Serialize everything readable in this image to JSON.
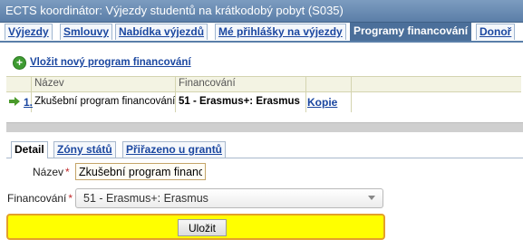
{
  "window": {
    "title": "ECTS koordinátor: Výjezdy studentů na krátkodobý pobyt (S035)"
  },
  "tabs": [
    {
      "label": "Výjezdy"
    },
    {
      "label": "Smlouvy"
    },
    {
      "label": "Nabídka výjezdů"
    },
    {
      "label": "Mé přihlášky na výjezdy"
    },
    {
      "label": "Programy financování"
    },
    {
      "label": "Donoř"
    }
  ],
  "toolbar": {
    "insert_label": "Vložit nový program financování",
    "insert_icon": "plus-circle-icon"
  },
  "grid": {
    "columns": [
      "Název",
      "Financování"
    ],
    "rows": [
      {
        "index": "1.",
        "name": "Zkušební program financování",
        "financing": "51 - Erasmus+: Erasmus",
        "action": "Kopie"
      }
    ]
  },
  "detail_tabs": [
    {
      "label": "Detail"
    },
    {
      "label": "Zóny států"
    },
    {
      "label": "Přiřazeno u grantů"
    }
  ],
  "form": {
    "name_label": "Název",
    "name_value": "Zkušební program financování",
    "financing_label": "Financování",
    "financing_value": "51 - Erasmus+: Erasmus",
    "required_mark": "*",
    "save_label": "Uložit"
  },
  "colors": {
    "accent": "#4b6f9a",
    "link": "#1b47a0",
    "savebar": "#ffff00",
    "required": "#c0282a"
  }
}
